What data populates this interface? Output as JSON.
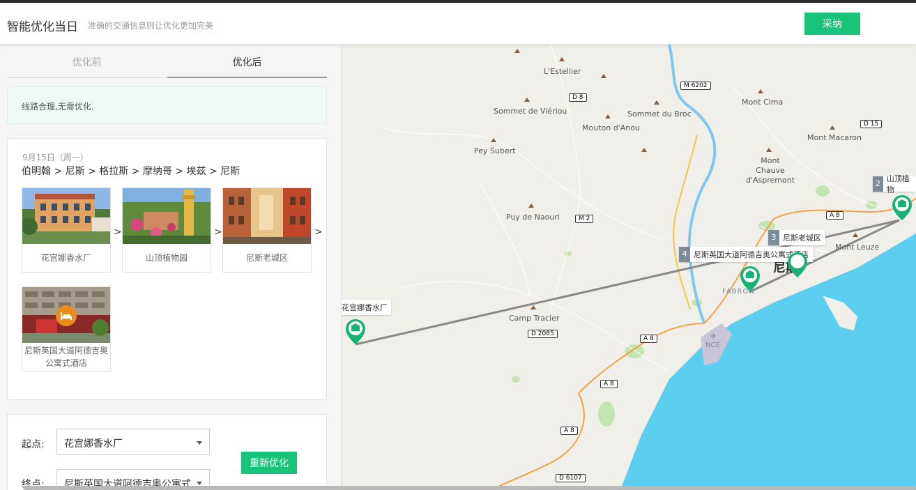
{
  "header": {
    "title": "智能优化当日",
    "subtitle": "准确的交通信息则让优化更加完美",
    "accept_label": "采纳"
  },
  "tabs": [
    {
      "label": "优化前",
      "active": false
    },
    {
      "label": "优化后",
      "active": true
    }
  ],
  "notice": "线路合理,无需优化.",
  "route": {
    "date": "9月15日（周一）",
    "path": "伯明翰 > 尼斯 > 格拉斯 > 摩纳哥 > 埃兹 > 尼斯",
    "pois": [
      {
        "name": "花宫娜香水厂"
      },
      {
        "name": "山顶植物园"
      },
      {
        "name": "尼斯老城区"
      },
      {
        "name": "尼斯英国大道阿德吉奥公寓式酒店",
        "icon": "hotel-icon"
      }
    ],
    "separator": ">"
  },
  "form": {
    "start_label": "起点:",
    "start_value": "花宫娜香水厂",
    "end_label": "终点:",
    "end_value": "尼斯英国大道阿德吉奥公寓式...",
    "reoptimize_label": "重新优化"
  },
  "map": {
    "places": [
      "L'Estellier",
      "Sommet de Viériou",
      "Sommet du Broc",
      "Mouton d'Anou",
      "Mont Cima",
      "Mont Macaron",
      "Pey Subert",
      "Mont Chauve d'Aspremont",
      "Puy de Naouri",
      "Mont Leuze",
      "Camp Tracier",
      "FABRON",
      "NCE",
      "尼斯"
    ],
    "roads": [
      "M 6202",
      "D 8",
      "D 15",
      "M 2",
      "A 8",
      "D 2085",
      "D 6107"
    ],
    "markers": [
      {
        "num": "2",
        "label": "山顶植物"
      },
      {
        "num": "3",
        "label": "尼斯老城区"
      },
      {
        "num": "4",
        "label": "尼斯英国大道阿德吉奥公寓式酒店"
      },
      {
        "num": "",
        "label": "花宫娜香水厂"
      }
    ],
    "colors": {
      "marker": "#19b275",
      "sea": "#5ccef0",
      "land": "#f1efe9",
      "route_line": "#888888"
    }
  }
}
